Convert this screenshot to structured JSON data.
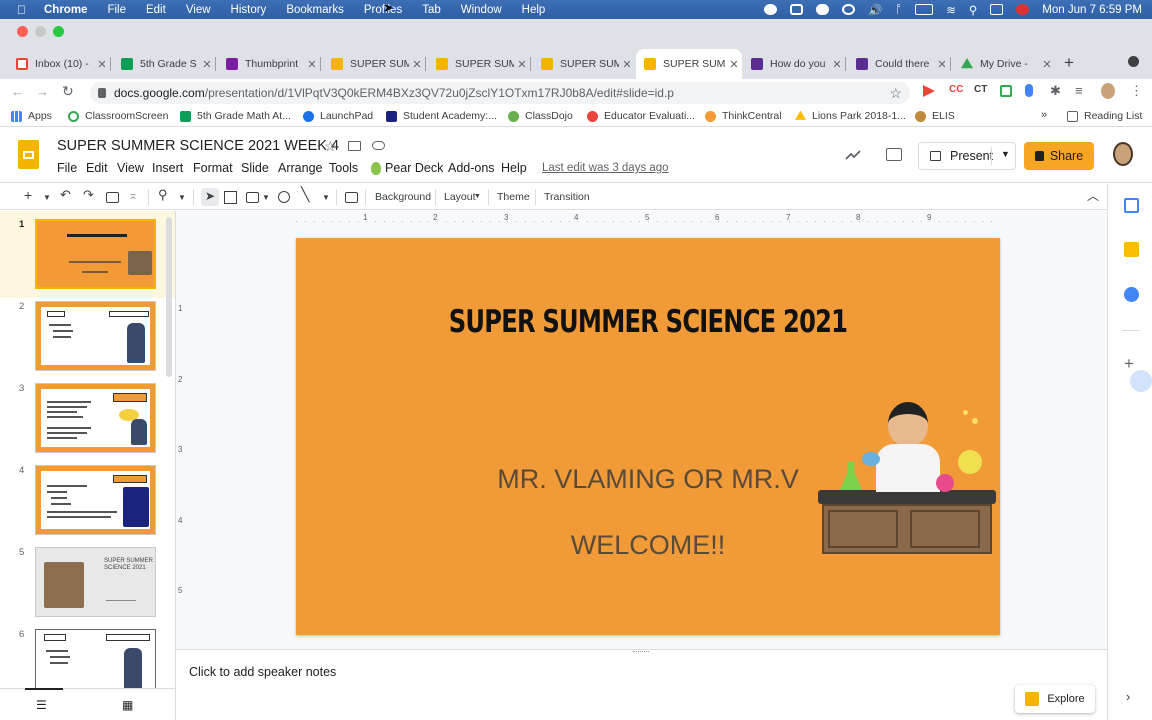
{
  "menubar": {
    "app": "Chrome",
    "items": [
      "File",
      "Edit",
      "View",
      "History",
      "Bookmarks",
      "Profiles",
      "Tab",
      "Window",
      "Help"
    ],
    "clock": "Mon Jun 7  6:59 PM"
  },
  "tabs": [
    {
      "label": "Inbox (10) -",
      "color": "#ea4335"
    },
    {
      "label": "5th Grade S",
      "color": "#0f9d58"
    },
    {
      "label": "Thumbprint",
      "color": "#7b1fa2"
    },
    {
      "label": "SUPER SUM",
      "color": "#f4b400"
    },
    {
      "label": "SUPER SUM",
      "color": "#f4b400"
    },
    {
      "label": "SUPER SUM",
      "color": "#f4b400"
    },
    {
      "label": "SUPER SUM",
      "color": "#f4b400"
    },
    {
      "label": "How do you",
      "color": "#5c2d91"
    },
    {
      "label": "Could there",
      "color": "#5c2d91"
    },
    {
      "label": "My Drive -",
      "color": "#34a853"
    }
  ],
  "address": {
    "host": "docs.google.com",
    "path": "/presentation/d/1VlPqtV3Q0kERM4BXz3QV72u0jZsclY1OTxm17RJ0b8A/edit#slide=id.p"
  },
  "bookmarks": {
    "items": [
      "Apps",
      "ClassroomScreen",
      "5th Grade Math At...",
      "LaunchPad",
      "Student Academy:...",
      "ClassDojo",
      "Educator Evaluati...",
      "ThinkCentral",
      "Lions Park 2018-1...",
      "ELIS"
    ],
    "reading_list": "Reading List"
  },
  "doc": {
    "title": "SUPER SUMMER SCIENCE 2021 WEEK 4",
    "menus": [
      "File",
      "Edit",
      "View",
      "Insert",
      "Format",
      "Slide",
      "Arrange",
      "Tools",
      "Pear Deck",
      "Add-ons",
      "Help"
    ],
    "last_edit": "Last edit was 3 days ago",
    "present": "Present",
    "share": "Share"
  },
  "toolbar": {
    "background": "Background",
    "layout": "Layout",
    "theme": "Theme",
    "transition": "Transition"
  },
  "ruler": {
    "h": [
      "1",
      "2",
      "3",
      "4",
      "5",
      "6",
      "7",
      "8",
      "9"
    ],
    "v": [
      "1",
      "2",
      "3",
      "4",
      "5"
    ]
  },
  "slides": [
    {
      "num": "1"
    },
    {
      "num": "2"
    },
    {
      "num": "3"
    },
    {
      "num": "4"
    },
    {
      "num": "5",
      "text": "SUPER SUMMER SCIENCE 2021"
    },
    {
      "num": "6"
    }
  ],
  "slide": {
    "title": "SUPER SUMMER SCIENCE 2021",
    "line1": "MR. VLAMING OR MR.V",
    "line2": "WELCOME!!"
  },
  "notes": {
    "placeholder": "Click to add speaker notes"
  },
  "explore": "Explore"
}
